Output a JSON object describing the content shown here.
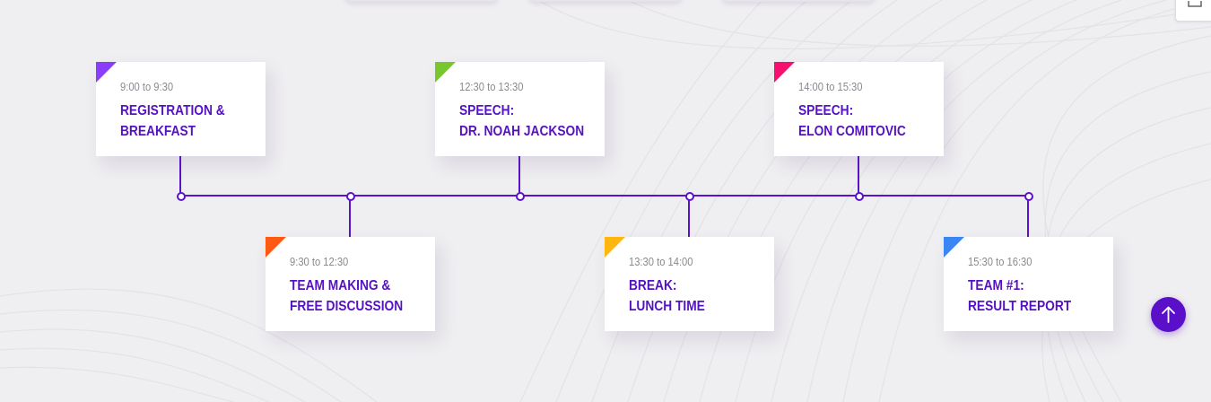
{
  "schedule": {
    "events": [
      {
        "time": "9:00 to 9:30",
        "title_line1": "Registration &",
        "title_line2": "Breakfast",
        "accent": "#8a3dfa"
      },
      {
        "time": "9:30 to 12:30",
        "title_line1": "Team Making &",
        "title_line2": "Free Discussion",
        "accent": "#ff5a12"
      },
      {
        "time": "12:30 to 13:30",
        "title_line1": "Speech:",
        "title_line2": "Dr. Noah Jackson",
        "accent": "#7ac62d"
      },
      {
        "time": "13:30 to 14:00",
        "title_line1": "Break:",
        "title_line2": "Lunch Time",
        "accent": "#ffb70f"
      },
      {
        "time": "14:00 to 15:30",
        "title_line1": "Speech:",
        "title_line2": "Elon Comitovic",
        "accent": "#f5106f"
      },
      {
        "time": "15:30 to 16:30",
        "title_line1": "Team #1:",
        "title_line2": "Result Report",
        "accent": "#3a86f5"
      }
    ]
  },
  "colors": {
    "timeline": "#5b12c9",
    "title_text": "#5512c2",
    "time_text": "#8a8990",
    "background": "#efeef0"
  },
  "controls": {
    "scroll_top_icon": "arrow-up-icon",
    "corner_icon": "download-icon"
  }
}
